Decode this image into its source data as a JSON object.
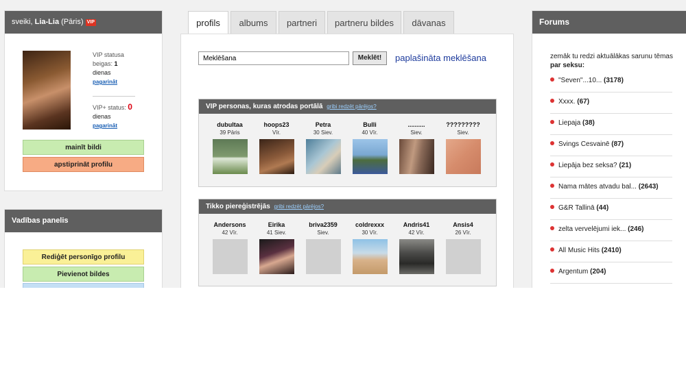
{
  "user": {
    "greeting": "sveiki,",
    "name": "Lia-Lia",
    "suffix": "(Pāris)",
    "vip_badge": "VIP",
    "vip_line1": "VIP statusa",
    "vip_line2": "beigas:",
    "vip_days_num": "1",
    "vip_days_word": "dienas",
    "vip_extend": "pagarināt",
    "vipplus_label": "VIP+ status:",
    "vipplus_num": "0",
    "vipplus_days_word": "dienas",
    "vipplus_extend": "pagarināt",
    "change_photo": "mainīt bildi",
    "confirm_profile": "apstiprināt profilu"
  },
  "control": {
    "title": "Vadības panelis",
    "edit_profile": "Rediģēt personīgo profilu",
    "add_photos": "Pievienot bildes"
  },
  "tabs": [
    "profils",
    "albums",
    "partneri",
    "partneru bildes",
    "dāvanas"
  ],
  "search": {
    "value": "Meklēšana",
    "button": "Meklēt!",
    "advanced": "paplašināta meklēšana"
  },
  "vip_section": {
    "title": "VIP personas, kuras atrodas portālā",
    "link": "gribi redzēt pārējos?",
    "people": [
      {
        "name": "dubultaa",
        "age": "39 Pāris"
      },
      {
        "name": "hoops23",
        "age": "Vīr."
      },
      {
        "name": "Petra",
        "age": "30 Siev."
      },
      {
        "name": "Bulli",
        "age": "40 Vīr."
      },
      {
        "name": "..........",
        "age": "Siev."
      },
      {
        "name": "?????????",
        "age": "Siev."
      }
    ]
  },
  "new_section": {
    "title": "Tikko piereģistrējās",
    "link": "gribi redzēt pārējos?",
    "people": [
      {
        "name": "Andersons",
        "age": "42 Vīr."
      },
      {
        "name": "Eirika",
        "age": "41 Siev."
      },
      {
        "name": "briva2359",
        "age": "Siev."
      },
      {
        "name": "coldrexxx",
        "age": "30 Vīr."
      },
      {
        "name": "Andris41",
        "age": "42 Vīr."
      },
      {
        "name": "Ansis4",
        "age": "26 Vīr."
      }
    ]
  },
  "forum": {
    "title": "Forums",
    "intro": "zemāk tu redzi aktuālākas sarunu tēmas",
    "intro_bold": "par seksu:",
    "topics": [
      {
        "title": "\"Seven\"...10...",
        "count": "(3178)"
      },
      {
        "title": "Xxxx.",
        "count": "(67)"
      },
      {
        "title": "Liepaja",
        "count": "(38)"
      },
      {
        "title": "Svings Cesvainē",
        "count": "(87)"
      },
      {
        "title": "Liepāja bez seksa?",
        "count": "(21)"
      },
      {
        "title": "Nama mātes atvadu bal...",
        "count": "(2643)"
      },
      {
        "title": "G&R Tallinā",
        "count": "(44)"
      },
      {
        "title": "zelta vervelējumi iek...",
        "count": "(246)"
      },
      {
        "title": "All Music Hits",
        "count": "(2410)"
      },
      {
        "title": "Argentum",
        "count": "(204)"
      }
    ]
  }
}
